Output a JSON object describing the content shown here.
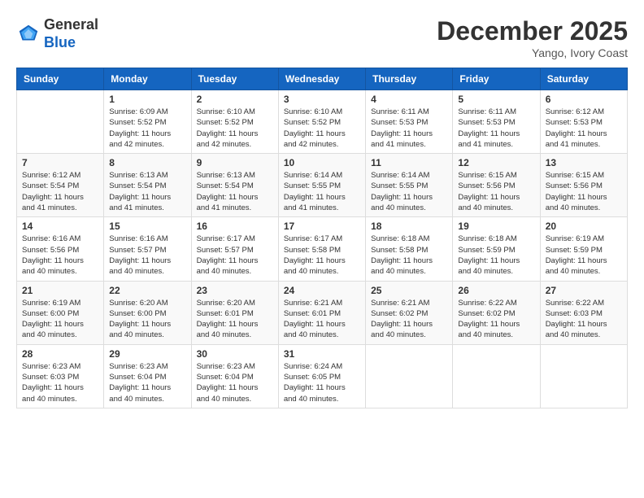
{
  "header": {
    "logo": {
      "general": "General",
      "blue": "Blue"
    },
    "month": "December 2025",
    "location": "Yango, Ivory Coast"
  },
  "weekdays": [
    "Sunday",
    "Monday",
    "Tuesday",
    "Wednesday",
    "Thursday",
    "Friday",
    "Saturday"
  ],
  "weeks": [
    [
      {
        "day": null,
        "sunrise": null,
        "sunset": null,
        "daylight": null
      },
      {
        "day": "1",
        "sunrise": "Sunrise: 6:09 AM",
        "sunset": "Sunset: 5:52 PM",
        "daylight": "Daylight: 11 hours and 42 minutes."
      },
      {
        "day": "2",
        "sunrise": "Sunrise: 6:10 AM",
        "sunset": "Sunset: 5:52 PM",
        "daylight": "Daylight: 11 hours and 42 minutes."
      },
      {
        "day": "3",
        "sunrise": "Sunrise: 6:10 AM",
        "sunset": "Sunset: 5:52 PM",
        "daylight": "Daylight: 11 hours and 42 minutes."
      },
      {
        "day": "4",
        "sunrise": "Sunrise: 6:11 AM",
        "sunset": "Sunset: 5:53 PM",
        "daylight": "Daylight: 11 hours and 41 minutes."
      },
      {
        "day": "5",
        "sunrise": "Sunrise: 6:11 AM",
        "sunset": "Sunset: 5:53 PM",
        "daylight": "Daylight: 11 hours and 41 minutes."
      },
      {
        "day": "6",
        "sunrise": "Sunrise: 6:12 AM",
        "sunset": "Sunset: 5:53 PM",
        "daylight": "Daylight: 11 hours and 41 minutes."
      }
    ],
    [
      {
        "day": "7",
        "sunrise": "Sunrise: 6:12 AM",
        "sunset": "Sunset: 5:54 PM",
        "daylight": "Daylight: 11 hours and 41 minutes."
      },
      {
        "day": "8",
        "sunrise": "Sunrise: 6:13 AM",
        "sunset": "Sunset: 5:54 PM",
        "daylight": "Daylight: 11 hours and 41 minutes."
      },
      {
        "day": "9",
        "sunrise": "Sunrise: 6:13 AM",
        "sunset": "Sunset: 5:54 PM",
        "daylight": "Daylight: 11 hours and 41 minutes."
      },
      {
        "day": "10",
        "sunrise": "Sunrise: 6:14 AM",
        "sunset": "Sunset: 5:55 PM",
        "daylight": "Daylight: 11 hours and 41 minutes."
      },
      {
        "day": "11",
        "sunrise": "Sunrise: 6:14 AM",
        "sunset": "Sunset: 5:55 PM",
        "daylight": "Daylight: 11 hours and 40 minutes."
      },
      {
        "day": "12",
        "sunrise": "Sunrise: 6:15 AM",
        "sunset": "Sunset: 5:56 PM",
        "daylight": "Daylight: 11 hours and 40 minutes."
      },
      {
        "day": "13",
        "sunrise": "Sunrise: 6:15 AM",
        "sunset": "Sunset: 5:56 PM",
        "daylight": "Daylight: 11 hours and 40 minutes."
      }
    ],
    [
      {
        "day": "14",
        "sunrise": "Sunrise: 6:16 AM",
        "sunset": "Sunset: 5:56 PM",
        "daylight": "Daylight: 11 hours and 40 minutes."
      },
      {
        "day": "15",
        "sunrise": "Sunrise: 6:16 AM",
        "sunset": "Sunset: 5:57 PM",
        "daylight": "Daylight: 11 hours and 40 minutes."
      },
      {
        "day": "16",
        "sunrise": "Sunrise: 6:17 AM",
        "sunset": "Sunset: 5:57 PM",
        "daylight": "Daylight: 11 hours and 40 minutes."
      },
      {
        "day": "17",
        "sunrise": "Sunrise: 6:17 AM",
        "sunset": "Sunset: 5:58 PM",
        "daylight": "Daylight: 11 hours and 40 minutes."
      },
      {
        "day": "18",
        "sunrise": "Sunrise: 6:18 AM",
        "sunset": "Sunset: 5:58 PM",
        "daylight": "Daylight: 11 hours and 40 minutes."
      },
      {
        "day": "19",
        "sunrise": "Sunrise: 6:18 AM",
        "sunset": "Sunset: 5:59 PM",
        "daylight": "Daylight: 11 hours and 40 minutes."
      },
      {
        "day": "20",
        "sunrise": "Sunrise: 6:19 AM",
        "sunset": "Sunset: 5:59 PM",
        "daylight": "Daylight: 11 hours and 40 minutes."
      }
    ],
    [
      {
        "day": "21",
        "sunrise": "Sunrise: 6:19 AM",
        "sunset": "Sunset: 6:00 PM",
        "daylight": "Daylight: 11 hours and 40 minutes."
      },
      {
        "day": "22",
        "sunrise": "Sunrise: 6:20 AM",
        "sunset": "Sunset: 6:00 PM",
        "daylight": "Daylight: 11 hours and 40 minutes."
      },
      {
        "day": "23",
        "sunrise": "Sunrise: 6:20 AM",
        "sunset": "Sunset: 6:01 PM",
        "daylight": "Daylight: 11 hours and 40 minutes."
      },
      {
        "day": "24",
        "sunrise": "Sunrise: 6:21 AM",
        "sunset": "Sunset: 6:01 PM",
        "daylight": "Daylight: 11 hours and 40 minutes."
      },
      {
        "day": "25",
        "sunrise": "Sunrise: 6:21 AM",
        "sunset": "Sunset: 6:02 PM",
        "daylight": "Daylight: 11 hours and 40 minutes."
      },
      {
        "day": "26",
        "sunrise": "Sunrise: 6:22 AM",
        "sunset": "Sunset: 6:02 PM",
        "daylight": "Daylight: 11 hours and 40 minutes."
      },
      {
        "day": "27",
        "sunrise": "Sunrise: 6:22 AM",
        "sunset": "Sunset: 6:03 PM",
        "daylight": "Daylight: 11 hours and 40 minutes."
      }
    ],
    [
      {
        "day": "28",
        "sunrise": "Sunrise: 6:23 AM",
        "sunset": "Sunset: 6:03 PM",
        "daylight": "Daylight: 11 hours and 40 minutes."
      },
      {
        "day": "29",
        "sunrise": "Sunrise: 6:23 AM",
        "sunset": "Sunset: 6:04 PM",
        "daylight": "Daylight: 11 hours and 40 minutes."
      },
      {
        "day": "30",
        "sunrise": "Sunrise: 6:23 AM",
        "sunset": "Sunset: 6:04 PM",
        "daylight": "Daylight: 11 hours and 40 minutes."
      },
      {
        "day": "31",
        "sunrise": "Sunrise: 6:24 AM",
        "sunset": "Sunset: 6:05 PM",
        "daylight": "Daylight: 11 hours and 40 minutes."
      },
      {
        "day": null,
        "sunrise": null,
        "sunset": null,
        "daylight": null
      },
      {
        "day": null,
        "sunrise": null,
        "sunset": null,
        "daylight": null
      },
      {
        "day": null,
        "sunrise": null,
        "sunset": null,
        "daylight": null
      }
    ]
  ]
}
